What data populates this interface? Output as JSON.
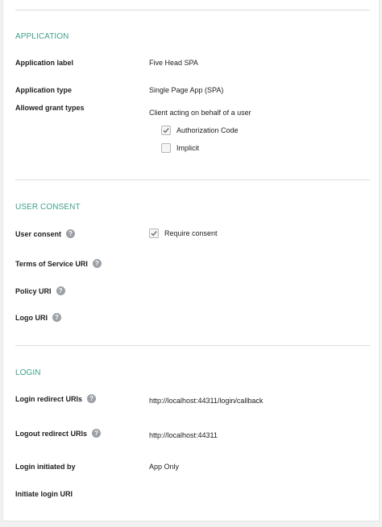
{
  "application": {
    "title": "APPLICATION",
    "label_label": "Application label",
    "label_value": "Five Head SPA",
    "type_label": "Application type",
    "type_value": "Single Page App (SPA)",
    "grants_label": "Allowed grant types",
    "grants_subtitle": "Client acting on behalf of a user",
    "grant_options": [
      {
        "label": "Authorization Code",
        "checked": true
      },
      {
        "label": "Implicit",
        "checked": false
      }
    ]
  },
  "consent": {
    "title": "USER CONSENT",
    "user_consent_label": "User consent",
    "require_consent_label": "Require consent",
    "require_consent_checked": true,
    "tos_label": "Terms of Service URI",
    "policy_label": "Policy URI",
    "logo_label": "Logo URI",
    "help_glyph": "?"
  },
  "login": {
    "title": "LOGIN",
    "redirect_label": "Login redirect URIs",
    "redirect_value": "http://localhost:44311/login/callback",
    "logout_label": "Logout redirect URIs",
    "logout_value": "http://localhost:44311",
    "initiated_label": "Login initiated by",
    "initiated_value": "App Only",
    "initiate_uri_label": "Initiate login URI"
  },
  "colors": {
    "accent": "#3fa08b",
    "help_icon": "#9aa0a6",
    "divider": "#dcdcdc"
  }
}
